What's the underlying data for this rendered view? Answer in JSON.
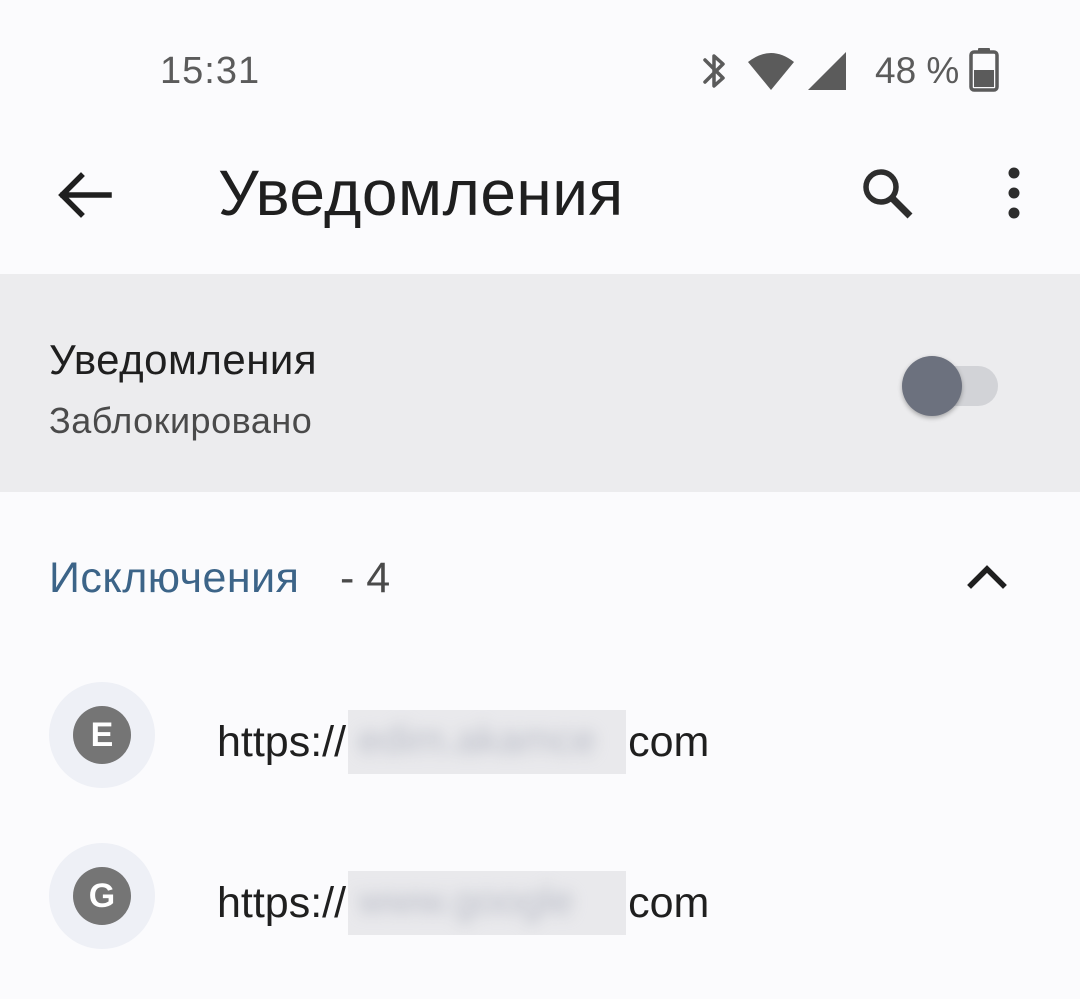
{
  "status_bar": {
    "time": "15:31",
    "battery_text": "48 %",
    "icons": [
      "bluetooth-icon",
      "wifi-icon",
      "cellular-signal-icon",
      "battery-icon"
    ]
  },
  "app_bar": {
    "title": "Уведомления",
    "back_icon": "arrow-left-icon",
    "search_icon": "search-icon",
    "more_icon": "more-vert-icon"
  },
  "master_toggle": {
    "title": "Уведомления",
    "subtitle": "Заблокировано",
    "state": "off"
  },
  "exceptions": {
    "label": "Исключения",
    "count_text": "- 4",
    "expanded": true,
    "items": [
      {
        "avatar_letter": "E",
        "url_prefix": "https://",
        "url_hidden": "edim.akamce",
        "url_suffix": "com"
      },
      {
        "avatar_letter": "G",
        "url_prefix": "https://",
        "url_hidden": "www.google",
        "url_suffix": "com"
      }
    ]
  },
  "colors": {
    "accent_blue": "#3c6488",
    "toggle_thumb": "#6c717e",
    "toggle_track": "#d2d3d7",
    "row_highlight": "#ececee",
    "avatar_bg": "#757575"
  }
}
